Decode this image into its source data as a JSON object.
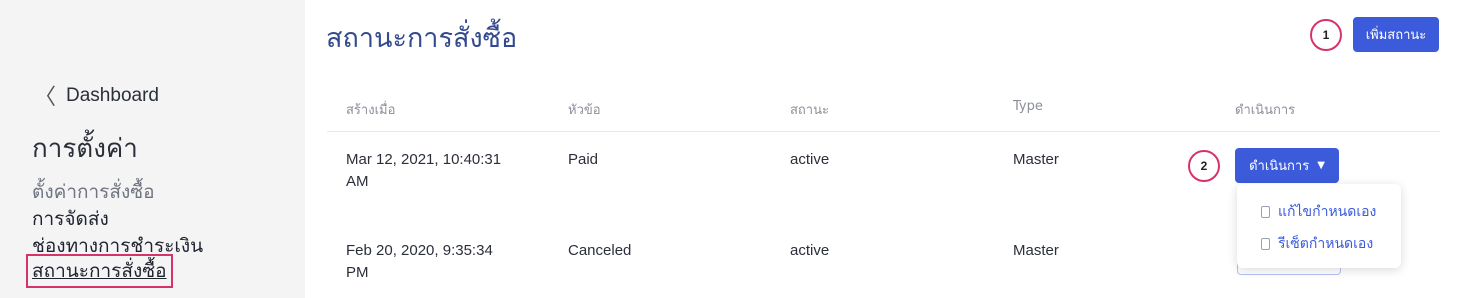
{
  "sidebar": {
    "back_label": "Dashboard",
    "section_title": "การตั้งค่า",
    "links": [
      "ตั้งค่าการสั่งซื้อ",
      "การจัดส่ง",
      "ช่องทางการชำระเงิน",
      "สถานะการสั่งซื้อ"
    ]
  },
  "header": {
    "title": "สถานะการสั่งซื้อ",
    "add_status_button": "เพิ่มสถานะ",
    "badge_1": "1"
  },
  "table": {
    "columns": [
      "สร้างเมื่อ",
      "หัวข้อ",
      "สถานะ",
      "Type",
      "ดำเนินการ"
    ],
    "rows": [
      {
        "created_line1": "Mar 12, 2021, 10:40:31",
        "created_line2": "AM",
        "title": "Paid",
        "status": "active",
        "type": "Master",
        "action": "ดำเนินการ"
      },
      {
        "created_line1": "Feb 20, 2020, 9:35:34",
        "created_line2": "PM",
        "title": "Canceled",
        "status": "active",
        "type": "Master"
      }
    ],
    "badge_2": "2"
  },
  "dropdown": {
    "items": [
      "แก้ไขกำหนดเอง",
      "รีเซ็ตกำหนดเอง"
    ]
  },
  "colors": {
    "primary": "#3b5bdb",
    "title": "#334a8f",
    "highlight": "#d6336c",
    "sidebar_bg": "#f4f4f5"
  }
}
